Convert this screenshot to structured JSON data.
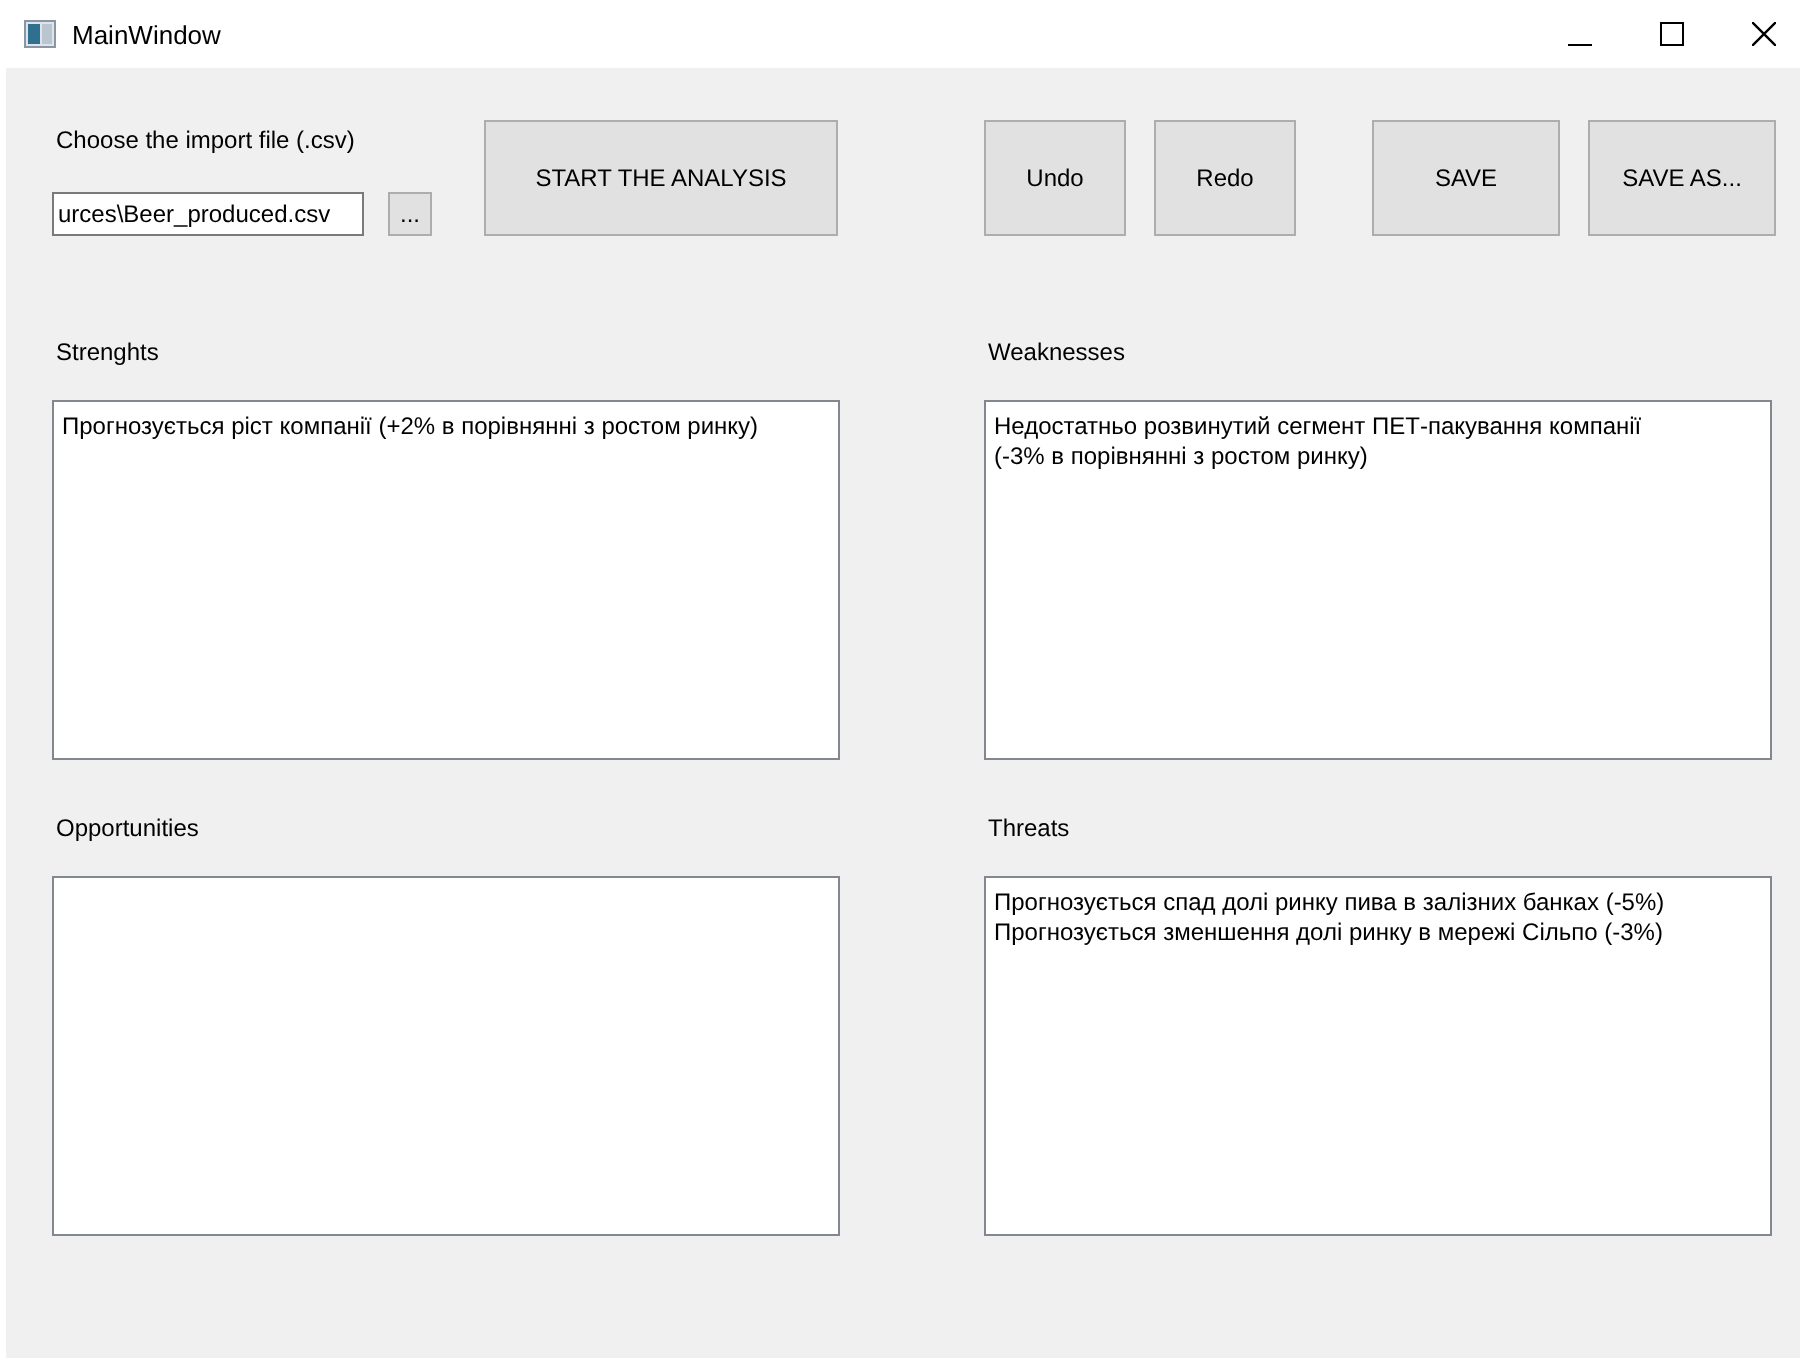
{
  "window": {
    "title": "MainWindow"
  },
  "import": {
    "label": "Choose the import file (.csv)",
    "value": "urces\\Beer_produced.csv",
    "browse": "..."
  },
  "buttons": [
    {
      "label": "START THE ANALYSIS",
      "kind": "start"
    },
    {
      "label": "Undo",
      "kind": "undo"
    },
    {
      "label": "Redo",
      "kind": "redo"
    },
    {
      "label": "SAVE",
      "kind": "save"
    },
    {
      "label": "SAVE AS...",
      "kind": "saveas"
    }
  ],
  "sections": [
    {
      "title": "Strenghts",
      "lines": [
        "Прогнозується ріст компанії (+2% в порівнянні з ростом ринку)"
      ]
    },
    {
      "title": "Weaknesses",
      "lines": [
        "Недостатньо розвинутий сегмент ПЕТ-пакування компанії",
        "(-3% в порівнянні з ростом ринку)"
      ]
    },
    {
      "title": "Opportunities"
    },
    {
      "title": "Threats",
      "lines": [
        "Прогнозується спад долі ринку пива в залізних банках (-5%)",
        "Прогнозується зменшення долі ринку в мережі Сільпо (-3%)"
      ]
    }
  ]
}
